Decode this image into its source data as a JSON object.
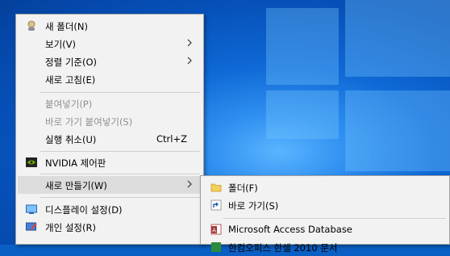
{
  "menu": {
    "items": [
      {
        "label": "새 폴더(N)"
      },
      {
        "label": "보기(V)"
      },
      {
        "label": "정렬 기준(O)"
      },
      {
        "label": "새로 고침(E)"
      },
      {
        "label": "붙여넣기(P)"
      },
      {
        "label": "바로 가기 붙여넣기(S)"
      },
      {
        "label": "실행 취소(U)",
        "shortcut": "Ctrl+Z"
      },
      {
        "label": "NVIDIA 제어판"
      },
      {
        "label": "새로 만들기(W)"
      },
      {
        "label": "디스플레이 설정(D)"
      },
      {
        "label": "개인 설정(R)"
      }
    ]
  },
  "submenu": {
    "items": [
      {
        "label": "폴더(F)"
      },
      {
        "label": "바로 가기(S)"
      },
      {
        "label": "Microsoft Access Database"
      },
      {
        "label": "한컴오피스 한셀 2010 문서"
      }
    ]
  },
  "colors": {
    "menu_bg": "#f2f2f2",
    "hover_bg": "#dcdcdc",
    "disabled_text": "#8f8f8f",
    "desktop_blue": "#0f69d6"
  }
}
